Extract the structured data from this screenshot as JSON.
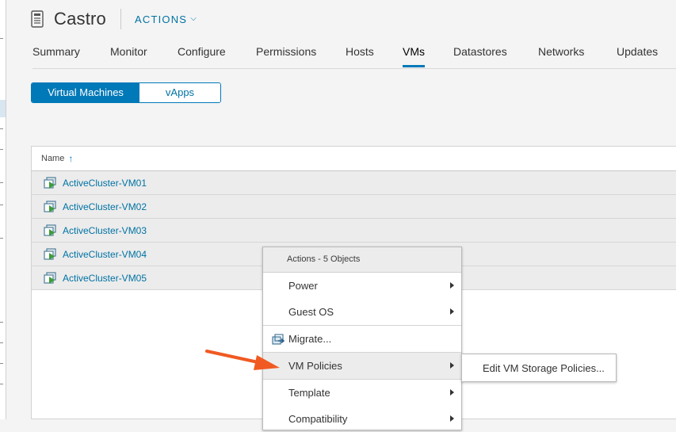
{
  "header": {
    "title": "Castro",
    "actions_label": "ACTIONS"
  },
  "tabs": [
    {
      "label": "Summary"
    },
    {
      "label": "Monitor"
    },
    {
      "label": "Configure"
    },
    {
      "label": "Permissions"
    },
    {
      "label": "Hosts"
    },
    {
      "label": "VMs"
    },
    {
      "label": "Datastores"
    },
    {
      "label": "Networks"
    },
    {
      "label": "Updates"
    }
  ],
  "active_tab": "VMs",
  "view_toggle": {
    "selected": "Virtual Machines",
    "other": "vApps"
  },
  "grid": {
    "column_name": "Name",
    "rows": [
      {
        "name": "ActiveCluster-VM01"
      },
      {
        "name": "ActiveCluster-VM02"
      },
      {
        "name": "ActiveCluster-VM03"
      },
      {
        "name": "ActiveCluster-VM04"
      },
      {
        "name": "ActiveCluster-VM05"
      }
    ]
  },
  "context_menu": {
    "header": "Actions - 5 Objects",
    "items": [
      {
        "label": "Power"
      },
      {
        "label": "Guest OS"
      },
      {
        "label": "Migrate..."
      },
      {
        "label": "VM Policies"
      },
      {
        "label": "Template"
      },
      {
        "label": "Compatibility"
      }
    ]
  },
  "submenu": {
    "item": "Edit VM Storage Policies..."
  },
  "colors": {
    "accent": "#0079b8",
    "link": "#0072a3",
    "arrow": "#f05a22"
  }
}
